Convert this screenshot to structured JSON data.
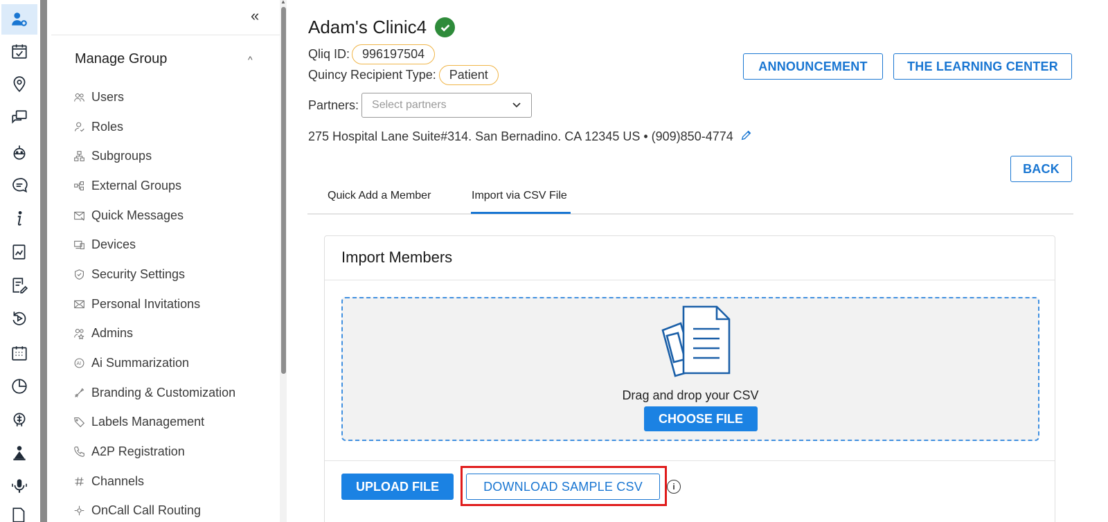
{
  "rail": {
    "icons": [
      "user-settings-icon",
      "calendar-check-icon",
      "location-pin-icon",
      "chat-bubbles-icon",
      "bot-icon",
      "message-icon",
      "info-icon",
      "report-icon",
      "edit-note-icon",
      "replay-icon",
      "calendar-grid-icon",
      "pie-chart-icon",
      "ai-head-icon",
      "org-icon",
      "voice-icon",
      "export-icon"
    ]
  },
  "sidebar": {
    "collapse_label": "«",
    "group_title": "Manage Group",
    "group_chevron": "^",
    "items": [
      {
        "label": "Users",
        "icon": "users-icon"
      },
      {
        "label": "Roles",
        "icon": "roles-icon"
      },
      {
        "label": "Subgroups",
        "icon": "subgroups-icon"
      },
      {
        "label": "External Groups",
        "icon": "external-groups-icon"
      },
      {
        "label": "Quick Messages",
        "icon": "quick-messages-icon"
      },
      {
        "label": "Devices",
        "icon": "devices-icon"
      },
      {
        "label": "Security Settings",
        "icon": "shield-icon"
      },
      {
        "label": "Personal Invitations",
        "icon": "envelope-icon"
      },
      {
        "label": "Admins",
        "icon": "admins-icon"
      },
      {
        "label": "Ai Summarization",
        "icon": "ai-icon"
      },
      {
        "label": "Branding & Customization",
        "icon": "branding-icon"
      },
      {
        "label": "Labels Management",
        "icon": "tag-icon"
      },
      {
        "label": "A2P Registration",
        "icon": "phone-icon"
      },
      {
        "label": "Channels",
        "icon": "hash-icon"
      },
      {
        "label": "OnCall Call Routing",
        "icon": "routing-icon"
      }
    ]
  },
  "header": {
    "title": "Adam's Clinic4",
    "qliq_label": "Qliq ID:",
    "qliq_id": "996197504",
    "recipient_label": "Quincy Recipient Type:",
    "recipient_type": "Patient",
    "partners_label": "Partners:",
    "partners_placeholder": "Select partners",
    "address": "275 Hospital Lane Suite#314. San Bernadino. CA 12345 US • (909)850-4774"
  },
  "buttons": {
    "announcement": "ANNOUNCEMENT",
    "learning_center": "THE LEARNING CENTER",
    "back": "BACK"
  },
  "tabs": [
    {
      "label": "Quick Add a Member",
      "active": false
    },
    {
      "label": "Import via CSV File",
      "active": true
    }
  ],
  "import": {
    "title": "Import Members",
    "drop_text": "Drag and drop your CSV",
    "choose_file": "CHOOSE FILE",
    "upload_file": "UPLOAD FILE",
    "download_sample": "DOWNLOAD SAMPLE CSV",
    "info_glyph": "i"
  },
  "colors": {
    "accent": "#1976d2",
    "primary_button": "#1b82e3",
    "pill_border": "#f0b548",
    "verified": "#2e8b3a",
    "highlight": "#e01b1b"
  }
}
